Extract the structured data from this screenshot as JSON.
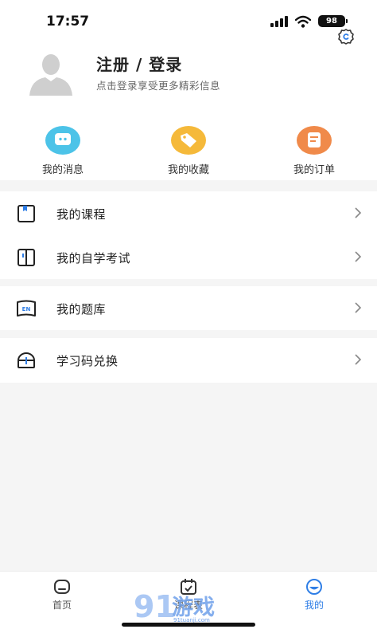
{
  "status_bar": {
    "time": "17:57",
    "battery": "98"
  },
  "profile": {
    "title": "注册 / 登录",
    "subtitle": "点击登录享受更多精彩信息"
  },
  "shortcuts": [
    {
      "label": "我的消息",
      "icon": "message-icon",
      "color": "#4cc3e8"
    },
    {
      "label": "我的收藏",
      "icon": "favorite-tag-icon",
      "color": "#f5b93a"
    },
    {
      "label": "我的订单",
      "icon": "order-icon",
      "color": "#f08a4a"
    }
  ],
  "menu_groups": [
    [
      {
        "label": "我的课程",
        "icon": "course-book-icon"
      },
      {
        "label": "我的自学考试",
        "icon": "exam-book-icon"
      }
    ],
    [
      {
        "label": "我的题库",
        "icon": "question-bank-icon"
      }
    ],
    [
      {
        "label": "学习码兑换",
        "icon": "redeem-code-icon"
      }
    ]
  ],
  "tabbar": {
    "tabs": [
      {
        "label": "首页",
        "icon": "home-icon"
      },
      {
        "label": "课程表",
        "icon": "schedule-icon"
      },
      {
        "label": "我的",
        "icon": "me-icon",
        "active": true
      }
    ],
    "active_color": "#2f7ee6"
  },
  "watermark": {
    "text": "游戏",
    "sub": "91tuanji.com"
  }
}
